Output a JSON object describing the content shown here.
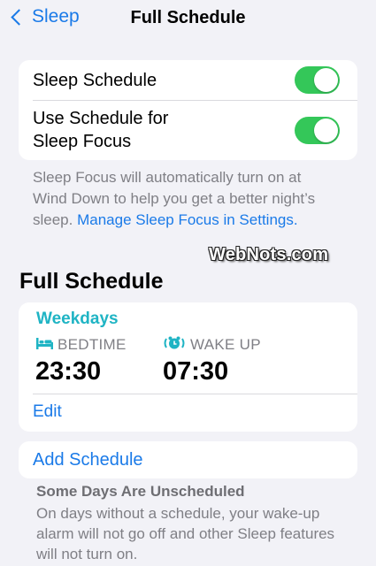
{
  "nav": {
    "back_label": "Sleep",
    "title": "Full Schedule"
  },
  "settings": {
    "sleep_schedule": {
      "label": "Sleep Schedule",
      "enabled": true
    },
    "use_schedule": {
      "label_line1": "Use Schedule for",
      "label_line2": "Sleep Focus",
      "enabled": true
    }
  },
  "footnote": {
    "text": "Sleep Focus will automatically turn on at Wind Down to help you get a better night’s sleep. ",
    "link": "Manage Sleep Focus in Settings."
  },
  "watermark": "WebNots.com",
  "full_schedule": {
    "section_title": "Full Schedule",
    "days": "Weekdays",
    "bedtime": {
      "label": "BEDTIME",
      "time": "23:30",
      "icon": "bed-icon"
    },
    "wakeup": {
      "label": "WAKE UP",
      "time": "07:30",
      "icon": "alarm-icon"
    },
    "edit_label": "Edit"
  },
  "add_schedule_label": "Add Schedule",
  "unscheduled": {
    "title": "Some Days Are Unscheduled",
    "body": "On days without a schedule, your wake-up alarm will not go off and other Sleep features will not turn on."
  },
  "colors": {
    "accent": "#1a7ae8",
    "toggle_on": "#34c759",
    "teal": "#1fb4c4",
    "background": "#f2f2f7"
  }
}
